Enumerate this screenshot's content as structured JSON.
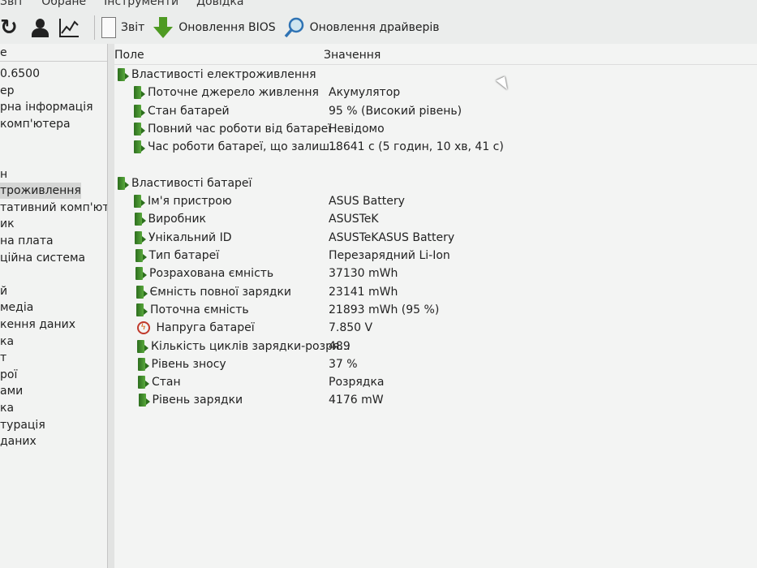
{
  "menu": [
    "Звіт",
    "Обране",
    "Інструменти",
    "Довідка"
  ],
  "toolbar": {
    "refresh": "refresh-icon",
    "user": "user-icon",
    "graph": "graph-icon",
    "report_label": "Звіт",
    "bios_label": "Оновлення BIOS",
    "drivers_label": "Оновлення драйверів"
  },
  "sidebar": {
    "header": "е",
    "items": [
      "0.6500",
      "ер",
      "рна інформація",
      "комп'ютера",
      "",
      "",
      "н",
      "троживлення",
      "тативний комп'юте",
      "ик",
      "на плата",
      "ційна система",
      "",
      "й",
      "медіа",
      "кення даних",
      "ка",
      "т",
      "рої",
      "ами",
      "ка",
      "турація",
      "даних"
    ],
    "selected_index": 7
  },
  "table": {
    "col_field": "Поле",
    "col_value": "Значення",
    "rows": [
      {
        "type": "group",
        "field": "Властивості електроживлення",
        "value": ""
      },
      {
        "type": "item",
        "field": "Поточне джерело живлення",
        "value": "Акумулятор"
      },
      {
        "type": "item",
        "field": "Стан батарей",
        "value": "95 % (Високий рівень)"
      },
      {
        "type": "item",
        "field": "Повний час роботи від батареї",
        "value": "Невідомо"
      },
      {
        "type": "item",
        "field": "Час роботи батареї, що залиш...",
        "value": "18641 с (5 годин, 10 хв, 41 с)"
      },
      {
        "type": "blank",
        "field": "",
        "value": ""
      },
      {
        "type": "group",
        "field": "Властивості батареї",
        "value": ""
      },
      {
        "type": "item",
        "field": "Ім'я пристрою",
        "value": "ASUS Battery"
      },
      {
        "type": "item",
        "field": "Виробник",
        "value": "ASUSTeK"
      },
      {
        "type": "item",
        "field": "Унікальний ID",
        "value": "ASUSTeKASUS Battery"
      },
      {
        "type": "item",
        "field": "Тип батареї",
        "value": "Перезарядний Li-Ion"
      },
      {
        "type": "item",
        "field": "Розрахована ємність",
        "value": "37130 mWh"
      },
      {
        "type": "item",
        "field": "Ємність повної зарядки",
        "value": "23141 mWh"
      },
      {
        "type": "item",
        "field": "Поточна ємність",
        "value": "21893 mWh  (95 %)"
      },
      {
        "type": "volt",
        "field": "Напруга батареї",
        "value": "7.850 V"
      },
      {
        "type": "item",
        "field": "Кількість циклів зарядки-розря...",
        "value": "489"
      },
      {
        "type": "item",
        "field": "Рівень зносу",
        "value": "37 %"
      },
      {
        "type": "item",
        "field": "Стан",
        "value": "Розрядка"
      },
      {
        "type": "item",
        "field": "Рівень зарядки",
        "value": "4176 mW"
      }
    ]
  }
}
